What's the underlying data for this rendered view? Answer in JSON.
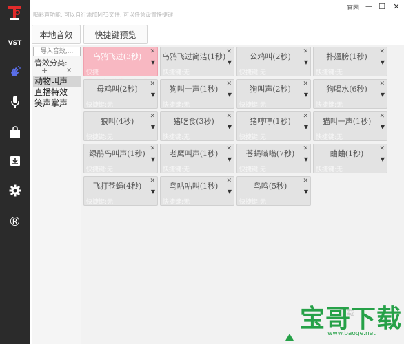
{
  "header": {
    "hint": "喝彩声功能, 可以自行添加MP3文件, 可以任意设置快捷键",
    "official_site": "官网",
    "minimize": "—",
    "maximize": "☐",
    "close": "✕"
  },
  "sidebar": {
    "vst_label": "VST",
    "registered_label": "®",
    "items": [
      {
        "icon": "logo-icon"
      },
      {
        "icon": "vst-icon"
      },
      {
        "icon": "applause-hand-icon"
      },
      {
        "icon": "microphone-icon"
      },
      {
        "icon": "shopping-bag-icon"
      },
      {
        "icon": "download-icon"
      },
      {
        "icon": "gear-icon"
      },
      {
        "icon": "registered-icon"
      }
    ]
  },
  "tabs": {
    "local_sounds": "本地音效",
    "hotkey_preview": "快捷键预览"
  },
  "categories": {
    "search_placeholder": "导入音效,...",
    "label": "音效分类:",
    "add": "+",
    "remove": "×",
    "items": [
      "动物叫声",
      "直播特效",
      "笑声掌声"
    ],
    "selected": "动物叫声"
  },
  "sounds": [
    {
      "name": "乌鸦飞过(3秒)",
      "hotkey": "快捷键:Ctrl+Shift+Alt+F",
      "active": true
    },
    {
      "name": "乌鸦飞过简洁(1秒)",
      "hotkey": "快捷键:无"
    },
    {
      "name": "公鸡叫(2秒)",
      "hotkey": "快捷键:无"
    },
    {
      "name": "扑翅膀(1秒)",
      "hotkey": "快捷键:无"
    },
    {
      "name": "母鸡叫(2秒)",
      "hotkey": "快捷键:无"
    },
    {
      "name": "狗叫一声(1秒)",
      "hotkey": "快捷键:无"
    },
    {
      "name": "狗叫声(2秒)",
      "hotkey": "快捷键:无"
    },
    {
      "name": "狗喝水(6秒)",
      "hotkey": "快捷键:无"
    },
    {
      "name": "狼叫(4秒)",
      "hotkey": "快捷键:无"
    },
    {
      "name": "猪吃食(3秒)",
      "hotkey": "快捷键:无"
    },
    {
      "name": "猪哼哼(1秒)",
      "hotkey": "快捷键:无"
    },
    {
      "name": "猫叫一声(1秒)",
      "hotkey": "快捷键:无"
    },
    {
      "name": "绿鹃鸟叫声(1秒)",
      "hotkey": "快捷键:无"
    },
    {
      "name": "老鹰叫声(1秒)",
      "hotkey": "快捷键:无"
    },
    {
      "name": "苍蝇嗡嗡(7秒)",
      "hotkey": "快捷键:无"
    },
    {
      "name": "蛐蛐(1秒)",
      "hotkey": "快捷键:无"
    },
    {
      "name": "飞打苍蝇(4秒)",
      "hotkey": "快捷键:无"
    },
    {
      "name": "鸟咕咕叫(1秒)",
      "hotkey": "快捷键:无"
    },
    {
      "name": "鸟鸣(5秒)",
      "hotkey": "快捷键:无"
    }
  ],
  "card_close": "✕",
  "card_dropdown": "▼",
  "watermark": {
    "title": "宝哥下载",
    "url": "www.baoge.net",
    "ghost": "下载",
    "color": "#26a148"
  },
  "colors": {
    "sidebar_bg": "#2b2b2b",
    "active_card": "#f8b8c2",
    "card_bg": "#e3e3e3"
  }
}
